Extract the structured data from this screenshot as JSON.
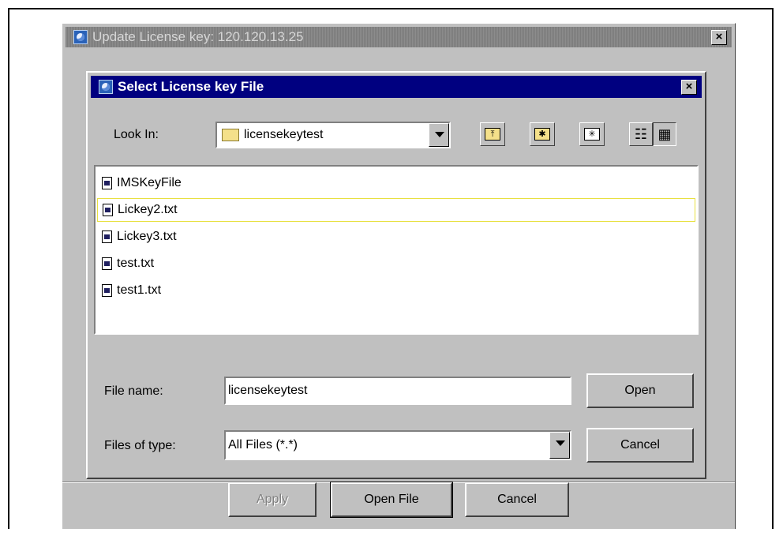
{
  "outer_window": {
    "title": "Update License key: 120.120.13.25",
    "close_label": "×"
  },
  "dialog": {
    "title": "Select License key File",
    "close_label": "×",
    "look_in_label": "Look In:",
    "look_in_value": "licensekeytest",
    "toolbar": {
      "up_label": "⤒",
      "home_label": "✱",
      "new_folder_label": "✳",
      "list_view_label": "☷",
      "details_view_label": "▦"
    },
    "files": [
      {
        "name": "IMSKeyFile"
      },
      {
        "name": "Lickey2.txt"
      },
      {
        "name": "Lickey3.txt"
      },
      {
        "name": "test.txt"
      },
      {
        "name": "test1.txt"
      }
    ],
    "file_name_label": "File name:",
    "file_name_value": "licensekeytest",
    "files_of_type_label": "Files of type:",
    "files_of_type_value": "All Files (*.*)",
    "open_label": "Open",
    "cancel_label": "Cancel"
  },
  "footer": {
    "apply_label": "Apply",
    "open_file_label": "Open File",
    "cancel_label": "Cancel"
  },
  "colors": {
    "dialog_title_bg": "#000080",
    "window_bg": "#c0c0c0",
    "selection_border": "#e8e040"
  }
}
